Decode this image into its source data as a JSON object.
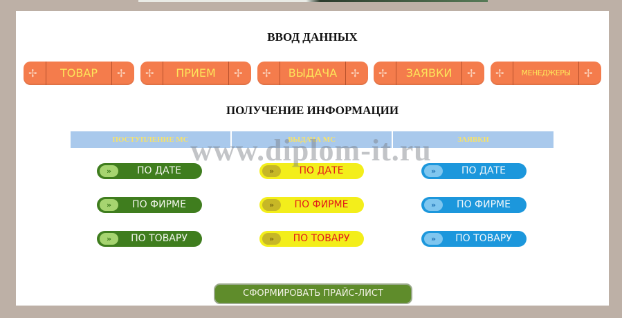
{
  "page": {
    "input_title": "ВВОД ДАННЫХ",
    "info_title": "ПОЛУЧЕНИЕ ИНФОРМАЦИИ"
  },
  "nav": {
    "items": [
      {
        "label": "ТОВАР"
      },
      {
        "label": "ПРИЕМ"
      },
      {
        "label": "ВЫДАЧА"
      },
      {
        "label": "ЗАЯВКИ"
      },
      {
        "label": "МЕНЕДЖЕРЫ"
      }
    ],
    "ornament": "✢"
  },
  "columns": [
    {
      "header": "ПОСТУПЛЕНИЕ МС",
      "color": "#3f7d1e",
      "buttons": [
        {
          "label": "ПО ДАТЕ"
        },
        {
          "label": "ПО ФИРМЕ"
        },
        {
          "label": "ПО ТОВАРУ"
        }
      ]
    },
    {
      "header": "ВЫДАЧА МС",
      "color": "#f3ee1b",
      "buttons": [
        {
          "label": "ПО ДАТЕ"
        },
        {
          "label": "ПО ФИРМЕ"
        },
        {
          "label": "ПО ТОВАРУ"
        }
      ]
    },
    {
      "header": "ЗАЯВКИ",
      "color": "#1c97dc",
      "buttons": [
        {
          "label": "ПО ДАТЕ"
        },
        {
          "label": "ПО ФИРМЕ"
        },
        {
          "label": "ПО ТОВАРУ"
        }
      ]
    }
  ],
  "arrow_glyph": "»",
  "price_button": {
    "label": "СФОРМИРОВАТЬ ПРАЙС-ЛИСТ"
  },
  "watermark": "www.diplom-it.ru"
}
